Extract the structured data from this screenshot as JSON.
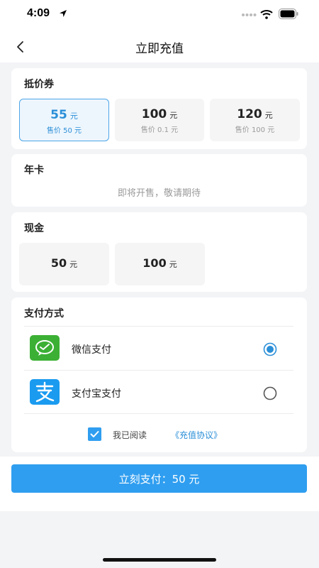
{
  "status_bar": {
    "time": "4:09",
    "location_icon": "location-arrow-icon",
    "signal_icon": "cellular-signal-icon",
    "wifi_icon": "wifi-icon",
    "battery_icon": "battery-full-icon"
  },
  "nav": {
    "back_icon": "chevron-left-icon",
    "title": "立即充值"
  },
  "coupon": {
    "title": "抵价券",
    "options": [
      {
        "amount": "55",
        "unit": "元",
        "sub": "售价 50 元",
        "selected": true
      },
      {
        "amount": "100",
        "unit": "元",
        "sub": "售价 0.1 元",
        "selected": false
      },
      {
        "amount": "120",
        "unit": "元",
        "sub": "售价 100 元",
        "selected": false
      }
    ]
  },
  "annual": {
    "title": "年卡",
    "note": "即将开售，敬请期待"
  },
  "cash": {
    "title": "现金",
    "options": [
      {
        "amount": "50",
        "unit": "元"
      },
      {
        "amount": "100",
        "unit": "元"
      }
    ]
  },
  "payment": {
    "title": "支付方式",
    "methods": [
      {
        "label": "微信支付",
        "icon": "wechat-pay-icon",
        "selected": true
      },
      {
        "label": "支付宝支付",
        "icon": "alipay-icon",
        "selected": false
      }
    ],
    "agree_text": "我已阅读",
    "agree_link": "《充值协议》",
    "agreed": true
  },
  "pay_button": {
    "label": "立刻支付：50 元"
  },
  "colors": {
    "accent": "#2f9ef0",
    "selected_border": "#4ea5e8",
    "wechat_green": "#3cb035",
    "alipay_blue": "#1a9bf0"
  }
}
